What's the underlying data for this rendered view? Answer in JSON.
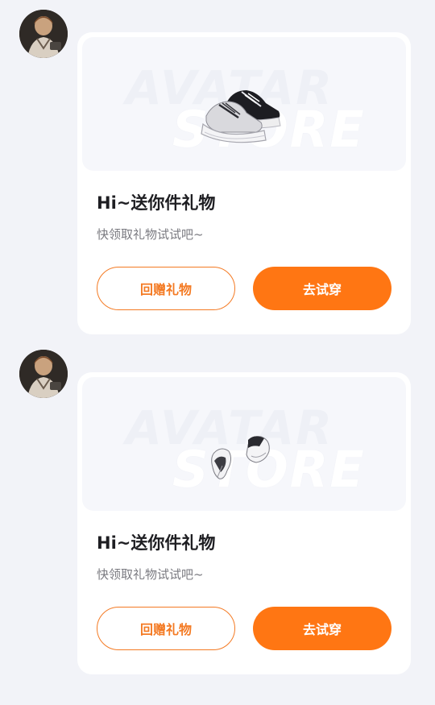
{
  "messages": [
    {
      "avatar_icon": "user-avatar-photo",
      "item_icon": "sneaker-icon",
      "watermark_line1": "AVATAR",
      "watermark_line2": "STORE",
      "title": "Hi~送你件礼物",
      "subtitle": "快领取礼物试试吧~",
      "return_gift_label": "回赠礼物",
      "try_on_label": "去试穿"
    },
    {
      "avatar_icon": "user-avatar-photo",
      "item_icon": "gloves-icon",
      "watermark_line1": "AVATAR",
      "watermark_line2": "STORE",
      "title": "Hi~送你件礼物",
      "subtitle": "快领取礼物试试吧~",
      "return_gift_label": "回赠礼物",
      "try_on_label": "去试穿"
    }
  ],
  "colors": {
    "page_bg": "#f2f3f8",
    "accent": "#ff7613",
    "card_bg": "#ffffff",
    "banner_bg": "#f6f7fb"
  }
}
